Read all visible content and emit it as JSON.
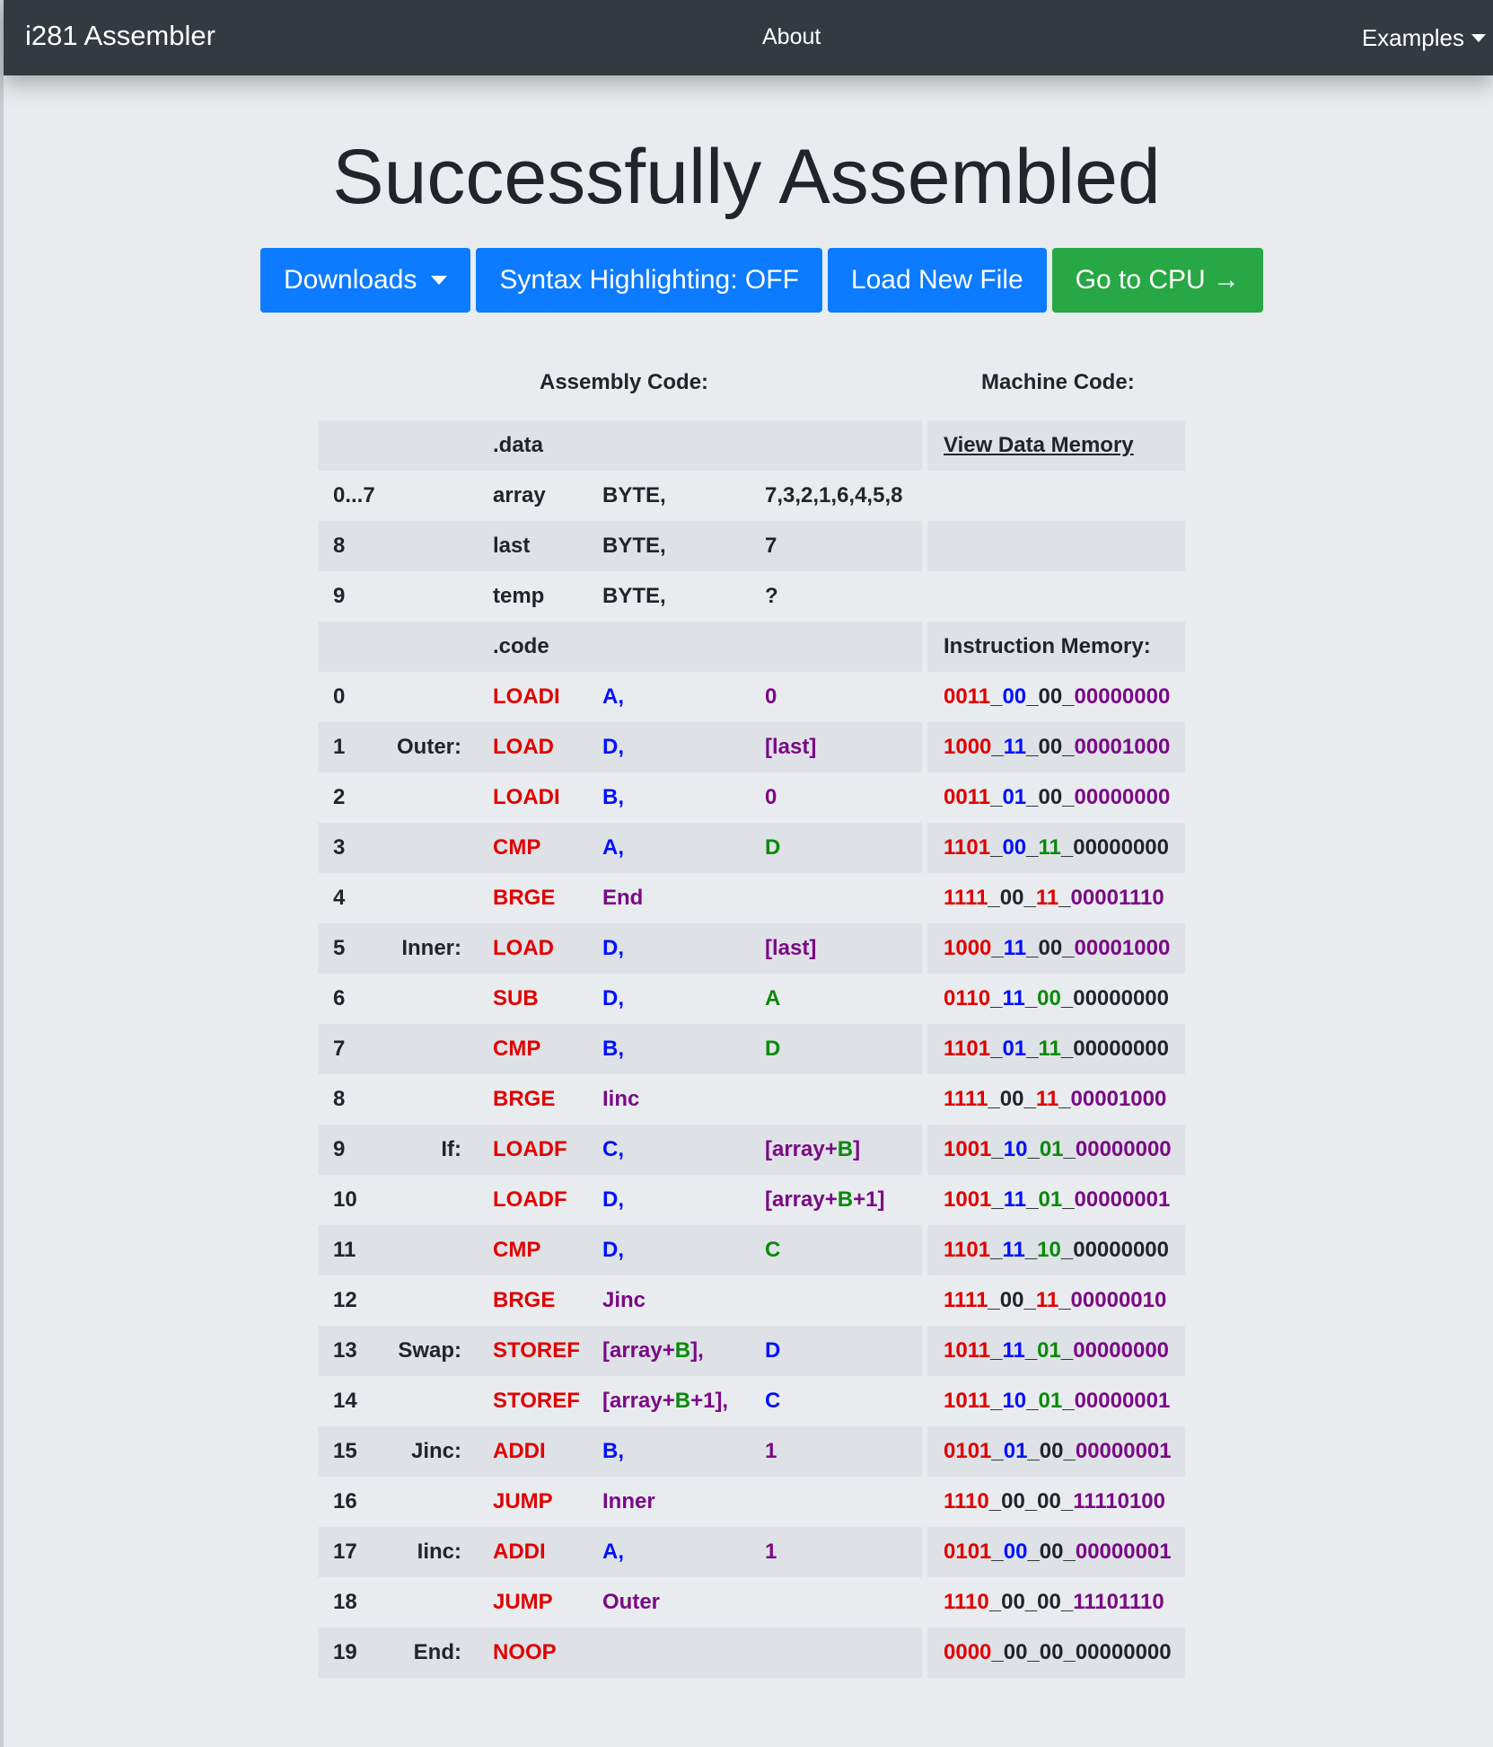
{
  "navbar": {
    "brand": "i281 Assembler",
    "about": "About",
    "examples": "Examples"
  },
  "page": {
    "title": "Successfully Assembled"
  },
  "toolbar": {
    "downloads": "Downloads",
    "syntax": "Syntax Highlighting: OFF",
    "load": "Load New File",
    "cpu": "Go to CPU →"
  },
  "headers": {
    "assembly": "Assembly Code:",
    "machine": "Machine Code:"
  },
  "colors": {
    "opcode": "#e00000",
    "register": "#0010ff",
    "address": "#7a0a85",
    "register2": "#0a8a0a",
    "navbar": "#343a40",
    "primary": "#0d7bff",
    "success": "#28a745"
  },
  "rows": [
    {
      "num": "",
      "label": "",
      "op": ".data",
      "opc": "dark",
      "a1": [],
      "a2": [],
      "mc": [
        {
          "t": "View Data Memory",
          "c": "link"
        }
      ]
    },
    {
      "num": "0...7",
      "label": "",
      "op": "array",
      "opc": "dark",
      "a1": [
        {
          "t": "BYTE,",
          "c": "dark"
        }
      ],
      "a2": [
        {
          "t": "7,3,2,1,6,4,5,8",
          "c": "dark"
        }
      ],
      "mc": []
    },
    {
      "num": "8",
      "label": "",
      "op": "last",
      "opc": "dark",
      "a1": [
        {
          "t": "BYTE,",
          "c": "dark"
        }
      ],
      "a2": [
        {
          "t": "7",
          "c": "dark"
        }
      ],
      "mc": []
    },
    {
      "num": "9",
      "label": "",
      "op": "temp",
      "opc": "dark",
      "a1": [
        {
          "t": "BYTE,",
          "c": "dark"
        }
      ],
      "a2": [
        {
          "t": "?",
          "c": "dark"
        }
      ],
      "mc": []
    },
    {
      "num": "",
      "label": "",
      "op": ".code",
      "opc": "dark",
      "a1": [],
      "a2": [],
      "mc": [
        {
          "t": "Instruction Memory:",
          "c": "dark"
        }
      ]
    },
    {
      "num": "0",
      "label": "",
      "op": "LOADI",
      "opc": "red",
      "a1": [
        {
          "t": "A,",
          "c": "blue"
        }
      ],
      "a2": [
        {
          "t": "0",
          "c": "purple"
        }
      ],
      "mc": [
        {
          "t": "0011",
          "c": "red"
        },
        {
          "t": "_",
          "c": "dark"
        },
        {
          "t": "00",
          "c": "blue"
        },
        {
          "t": "_00_",
          "c": "dark"
        },
        {
          "t": "00000000",
          "c": "purple"
        }
      ]
    },
    {
      "num": "1",
      "label": "Outer:",
      "op": "LOAD",
      "opc": "red",
      "a1": [
        {
          "t": "D,",
          "c": "blue"
        }
      ],
      "a2": [
        {
          "t": "[last]",
          "c": "purple"
        }
      ],
      "mc": [
        {
          "t": "1000",
          "c": "red"
        },
        {
          "t": "_",
          "c": "dark"
        },
        {
          "t": "11",
          "c": "blue"
        },
        {
          "t": "_00_",
          "c": "dark"
        },
        {
          "t": "00001000",
          "c": "purple"
        }
      ]
    },
    {
      "num": "2",
      "label": "",
      "op": "LOADI",
      "opc": "red",
      "a1": [
        {
          "t": "B,",
          "c": "blue"
        }
      ],
      "a2": [
        {
          "t": "0",
          "c": "purple"
        }
      ],
      "mc": [
        {
          "t": "0011",
          "c": "red"
        },
        {
          "t": "_",
          "c": "dark"
        },
        {
          "t": "01",
          "c": "blue"
        },
        {
          "t": "_00_",
          "c": "dark"
        },
        {
          "t": "00000000",
          "c": "purple"
        }
      ]
    },
    {
      "num": "3",
      "label": "",
      "op": "CMP",
      "opc": "red",
      "a1": [
        {
          "t": "A,",
          "c": "blue"
        }
      ],
      "a2": [
        {
          "t": "D",
          "c": "green"
        }
      ],
      "mc": [
        {
          "t": "1101",
          "c": "red"
        },
        {
          "t": "_",
          "c": "dark"
        },
        {
          "t": "00",
          "c": "blue"
        },
        {
          "t": "_",
          "c": "dark"
        },
        {
          "t": "11",
          "c": "green"
        },
        {
          "t": "_00000000",
          "c": "dark"
        }
      ]
    },
    {
      "num": "4",
      "label": "",
      "op": "BRGE",
      "opc": "red",
      "a1": [
        {
          "t": "End",
          "c": "purple"
        }
      ],
      "a2": [],
      "mc": [
        {
          "t": "1111",
          "c": "red"
        },
        {
          "t": "_00_",
          "c": "dark"
        },
        {
          "t": "11",
          "c": "red"
        },
        {
          "t": "_",
          "c": "dark"
        },
        {
          "t": "00001110",
          "c": "purple"
        }
      ]
    },
    {
      "num": "5",
      "label": "Inner:",
      "op": "LOAD",
      "opc": "red",
      "a1": [
        {
          "t": "D,",
          "c": "blue"
        }
      ],
      "a2": [
        {
          "t": "[last]",
          "c": "purple"
        }
      ],
      "mc": [
        {
          "t": "1000",
          "c": "red"
        },
        {
          "t": "_",
          "c": "dark"
        },
        {
          "t": "11",
          "c": "blue"
        },
        {
          "t": "_00_",
          "c": "dark"
        },
        {
          "t": "00001000",
          "c": "purple"
        }
      ]
    },
    {
      "num": "6",
      "label": "",
      "op": "SUB",
      "opc": "red",
      "a1": [
        {
          "t": "D,",
          "c": "blue"
        }
      ],
      "a2": [
        {
          "t": "A",
          "c": "green"
        }
      ],
      "mc": [
        {
          "t": "0110",
          "c": "red"
        },
        {
          "t": "_",
          "c": "dark"
        },
        {
          "t": "11",
          "c": "blue"
        },
        {
          "t": "_",
          "c": "dark"
        },
        {
          "t": "00",
          "c": "green"
        },
        {
          "t": "_00000000",
          "c": "dark"
        }
      ]
    },
    {
      "num": "7",
      "label": "",
      "op": "CMP",
      "opc": "red",
      "a1": [
        {
          "t": "B,",
          "c": "blue"
        }
      ],
      "a2": [
        {
          "t": "D",
          "c": "green"
        }
      ],
      "mc": [
        {
          "t": "1101",
          "c": "red"
        },
        {
          "t": "_",
          "c": "dark"
        },
        {
          "t": "01",
          "c": "blue"
        },
        {
          "t": "_",
          "c": "dark"
        },
        {
          "t": "11",
          "c": "green"
        },
        {
          "t": "_00000000",
          "c": "dark"
        }
      ]
    },
    {
      "num": "8",
      "label": "",
      "op": "BRGE",
      "opc": "red",
      "a1": [
        {
          "t": "Iinc",
          "c": "purple"
        }
      ],
      "a2": [],
      "mc": [
        {
          "t": "1111",
          "c": "red"
        },
        {
          "t": "_00_",
          "c": "dark"
        },
        {
          "t": "11",
          "c": "red"
        },
        {
          "t": "_",
          "c": "dark"
        },
        {
          "t": "00001000",
          "c": "purple"
        }
      ]
    },
    {
      "num": "9",
      "label": "If:",
      "op": "LOADF",
      "opc": "red",
      "a1": [
        {
          "t": "C,",
          "c": "blue"
        }
      ],
      "a2": [
        {
          "t": "[array+",
          "c": "purple"
        },
        {
          "t": "B",
          "c": "green"
        },
        {
          "t": "]",
          "c": "purple"
        }
      ],
      "mc": [
        {
          "t": "1001",
          "c": "red"
        },
        {
          "t": "_",
          "c": "dark"
        },
        {
          "t": "10",
          "c": "blue"
        },
        {
          "t": "_",
          "c": "dark"
        },
        {
          "t": "01",
          "c": "green"
        },
        {
          "t": "_",
          "c": "dark"
        },
        {
          "t": "00000000",
          "c": "purple"
        }
      ]
    },
    {
      "num": "10",
      "label": "",
      "op": "LOADF",
      "opc": "red",
      "a1": [
        {
          "t": "D,",
          "c": "blue"
        }
      ],
      "a2": [
        {
          "t": "[array+",
          "c": "purple"
        },
        {
          "t": "B",
          "c": "green"
        },
        {
          "t": "+1]",
          "c": "purple"
        }
      ],
      "mc": [
        {
          "t": "1001",
          "c": "red"
        },
        {
          "t": "_",
          "c": "dark"
        },
        {
          "t": "11",
          "c": "blue"
        },
        {
          "t": "_",
          "c": "dark"
        },
        {
          "t": "01",
          "c": "green"
        },
        {
          "t": "_",
          "c": "dark"
        },
        {
          "t": "00000001",
          "c": "purple"
        }
      ]
    },
    {
      "num": "11",
      "label": "",
      "op": "CMP",
      "opc": "red",
      "a1": [
        {
          "t": "D,",
          "c": "blue"
        }
      ],
      "a2": [
        {
          "t": "C",
          "c": "green"
        }
      ],
      "mc": [
        {
          "t": "1101",
          "c": "red"
        },
        {
          "t": "_",
          "c": "dark"
        },
        {
          "t": "11",
          "c": "blue"
        },
        {
          "t": "_",
          "c": "dark"
        },
        {
          "t": "10",
          "c": "green"
        },
        {
          "t": "_00000000",
          "c": "dark"
        }
      ]
    },
    {
      "num": "12",
      "label": "",
      "op": "BRGE",
      "opc": "red",
      "a1": [
        {
          "t": "Jinc",
          "c": "purple"
        }
      ],
      "a2": [],
      "mc": [
        {
          "t": "1111",
          "c": "red"
        },
        {
          "t": "_00_",
          "c": "dark"
        },
        {
          "t": "11",
          "c": "red"
        },
        {
          "t": "_",
          "c": "dark"
        },
        {
          "t": "00000010",
          "c": "purple"
        }
      ]
    },
    {
      "num": "13",
      "label": "Swap:",
      "op": "STOREF",
      "opc": "red",
      "a1": [
        {
          "t": "[array+",
          "c": "purple"
        },
        {
          "t": "B",
          "c": "green"
        },
        {
          "t": "],",
          "c": "purple"
        }
      ],
      "a2": [
        {
          "t": "D",
          "c": "blue"
        }
      ],
      "mc": [
        {
          "t": "1011",
          "c": "red"
        },
        {
          "t": "_",
          "c": "dark"
        },
        {
          "t": "11",
          "c": "blue"
        },
        {
          "t": "_",
          "c": "dark"
        },
        {
          "t": "01",
          "c": "green"
        },
        {
          "t": "_",
          "c": "dark"
        },
        {
          "t": "00000000",
          "c": "purple"
        }
      ]
    },
    {
      "num": "14",
      "label": "",
      "op": "STOREF",
      "opc": "red",
      "a1": [
        {
          "t": "[array+",
          "c": "purple"
        },
        {
          "t": "B",
          "c": "green"
        },
        {
          "t": "+1],",
          "c": "purple"
        }
      ],
      "a2": [
        {
          "t": "C",
          "c": "blue"
        }
      ],
      "mc": [
        {
          "t": "1011",
          "c": "red"
        },
        {
          "t": "_",
          "c": "dark"
        },
        {
          "t": "10",
          "c": "blue"
        },
        {
          "t": "_",
          "c": "dark"
        },
        {
          "t": "01",
          "c": "green"
        },
        {
          "t": "_",
          "c": "dark"
        },
        {
          "t": "00000001",
          "c": "purple"
        }
      ]
    },
    {
      "num": "15",
      "label": "Jinc:",
      "op": "ADDI",
      "opc": "red",
      "a1": [
        {
          "t": "B,",
          "c": "blue"
        }
      ],
      "a2": [
        {
          "t": "1",
          "c": "purple"
        }
      ],
      "mc": [
        {
          "t": "0101",
          "c": "red"
        },
        {
          "t": "_",
          "c": "dark"
        },
        {
          "t": "01",
          "c": "blue"
        },
        {
          "t": "_00_",
          "c": "dark"
        },
        {
          "t": "00000001",
          "c": "purple"
        }
      ]
    },
    {
      "num": "16",
      "label": "",
      "op": "JUMP",
      "opc": "red",
      "a1": [
        {
          "t": "Inner",
          "c": "purple"
        }
      ],
      "a2": [],
      "mc": [
        {
          "t": "1110",
          "c": "red"
        },
        {
          "t": "_00_00_",
          "c": "dark"
        },
        {
          "t": "11110100",
          "c": "purple"
        }
      ]
    },
    {
      "num": "17",
      "label": "Iinc:",
      "op": "ADDI",
      "opc": "red",
      "a1": [
        {
          "t": "A,",
          "c": "blue"
        }
      ],
      "a2": [
        {
          "t": "1",
          "c": "purple"
        }
      ],
      "mc": [
        {
          "t": "0101",
          "c": "red"
        },
        {
          "t": "_",
          "c": "dark"
        },
        {
          "t": "00",
          "c": "blue"
        },
        {
          "t": "_00_",
          "c": "dark"
        },
        {
          "t": "00000001",
          "c": "purple"
        }
      ]
    },
    {
      "num": "18",
      "label": "",
      "op": "JUMP",
      "opc": "red",
      "a1": [
        {
          "t": "Outer",
          "c": "purple"
        }
      ],
      "a2": [],
      "mc": [
        {
          "t": "1110",
          "c": "red"
        },
        {
          "t": "_00_00_",
          "c": "dark"
        },
        {
          "t": "11101110",
          "c": "purple"
        }
      ]
    },
    {
      "num": "19",
      "label": "End:",
      "op": "NOOP",
      "opc": "red",
      "a1": [],
      "a2": [],
      "mc": [
        {
          "t": "0000",
          "c": "red"
        },
        {
          "t": "_00_00_00000000",
          "c": "dark"
        }
      ]
    }
  ]
}
